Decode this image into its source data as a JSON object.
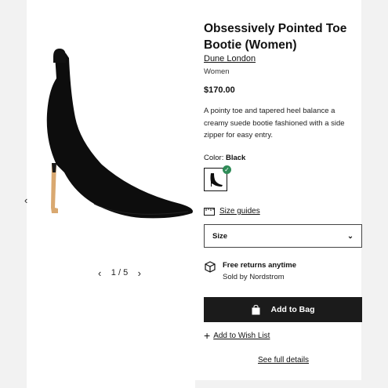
{
  "product": {
    "title": "Obsessively Pointed Toe Bootie (Women)",
    "brand": "Dune London",
    "department": "Women",
    "price": "$170.00",
    "description": "A pointy toe and tapered heel balance a creamy suede bootie fashioned with a side zipper for easy entry."
  },
  "gallery": {
    "pager": "1 / 5",
    "prev_arrow": "‹",
    "pager_prev": "‹",
    "pager_next": "›"
  },
  "color": {
    "label": "Color:",
    "selected": "Black",
    "check": "✓"
  },
  "size_guides": {
    "label": "Size guides"
  },
  "size_select": {
    "label": "Size",
    "caret": "⌄"
  },
  "returns": {
    "title": "Free returns anytime",
    "sold_by": "Sold by Nordstrom"
  },
  "actions": {
    "add_to_bag": "Add to Bag",
    "wish_plus": "+",
    "add_to_wish_list": "Add to Wish List",
    "see_full_details": "See full details"
  },
  "colors": {
    "button_bg": "#1b1b1b",
    "check_green": "#2e8b57",
    "frame": "#f2f2f2"
  }
}
